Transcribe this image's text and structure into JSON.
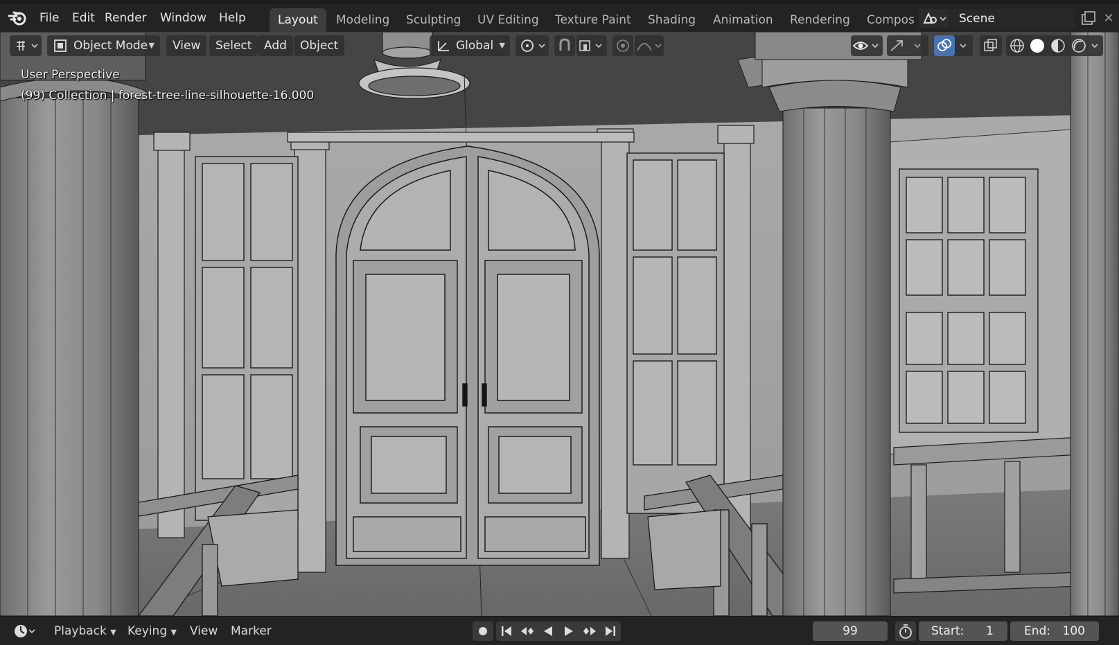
{
  "menu": {
    "file": "File",
    "edit": "Edit",
    "render": "Render",
    "window": "Window",
    "help": "Help"
  },
  "workspaces": [
    {
      "label": "Layout",
      "active": true
    },
    {
      "label": "Modeling",
      "active": false
    },
    {
      "label": "Sculpting",
      "active": false
    },
    {
      "label": "UV Editing",
      "active": false
    },
    {
      "label": "Texture Paint",
      "active": false
    },
    {
      "label": "Shading",
      "active": false
    },
    {
      "label": "Animation",
      "active": false
    },
    {
      "label": "Rendering",
      "active": false
    },
    {
      "label": "Compos",
      "active": false
    }
  ],
  "scene": {
    "name": "Scene"
  },
  "viewport_header": {
    "mode": "Object Mode",
    "menus": [
      "View",
      "Select",
      "Add",
      "Object"
    ],
    "transform_orientation": "Global"
  },
  "viewport": {
    "perspective_label": "User Perspective",
    "collection_info": "(99) Collection | forest-tree-line-silhouette-16.000"
  },
  "timeline": {
    "playback": "Playback",
    "keying": "Keying",
    "view": "View",
    "marker": "Marker",
    "current_frame": "99",
    "start_label": "Start:",
    "start_value": "1",
    "end_label": "End:",
    "end_value": "100"
  },
  "colors": {
    "ui_background": "#232323",
    "active_tab": "#3d3d3d",
    "viewport_background": "#555555",
    "solid_shading_active": "#ffffff",
    "overlay_active_blue": "#4772b3"
  },
  "icons": {
    "blender_logo": "blender-logo-icon",
    "editor_type": "editor-type-icon",
    "object_mode": "object-mode-icon",
    "transform": "transform-icon",
    "pivot": "pivot-point-icon",
    "snap": "snap-icon",
    "snap_element": "snap-element-icon",
    "proportional": "proportional-edit-icon",
    "falloff": "falloff-icon",
    "visibility": "eye-icon",
    "gizmo": "gizmo-icon",
    "overlays": "overlays-icon",
    "xray": "xray-icon",
    "wireframe": "wireframe-shading-icon",
    "solid": "solid-shading-icon",
    "material": "material-shading-icon",
    "rendered": "rendered-shading-icon",
    "record": "record-icon",
    "jump_start": "jump-start-icon",
    "prev_key": "prev-keyframe-icon",
    "play_reverse": "play-reverse-icon",
    "play": "play-icon",
    "next_key": "next-keyframe-icon",
    "jump_end": "jump-end-icon",
    "stopwatch": "stopwatch-icon"
  }
}
